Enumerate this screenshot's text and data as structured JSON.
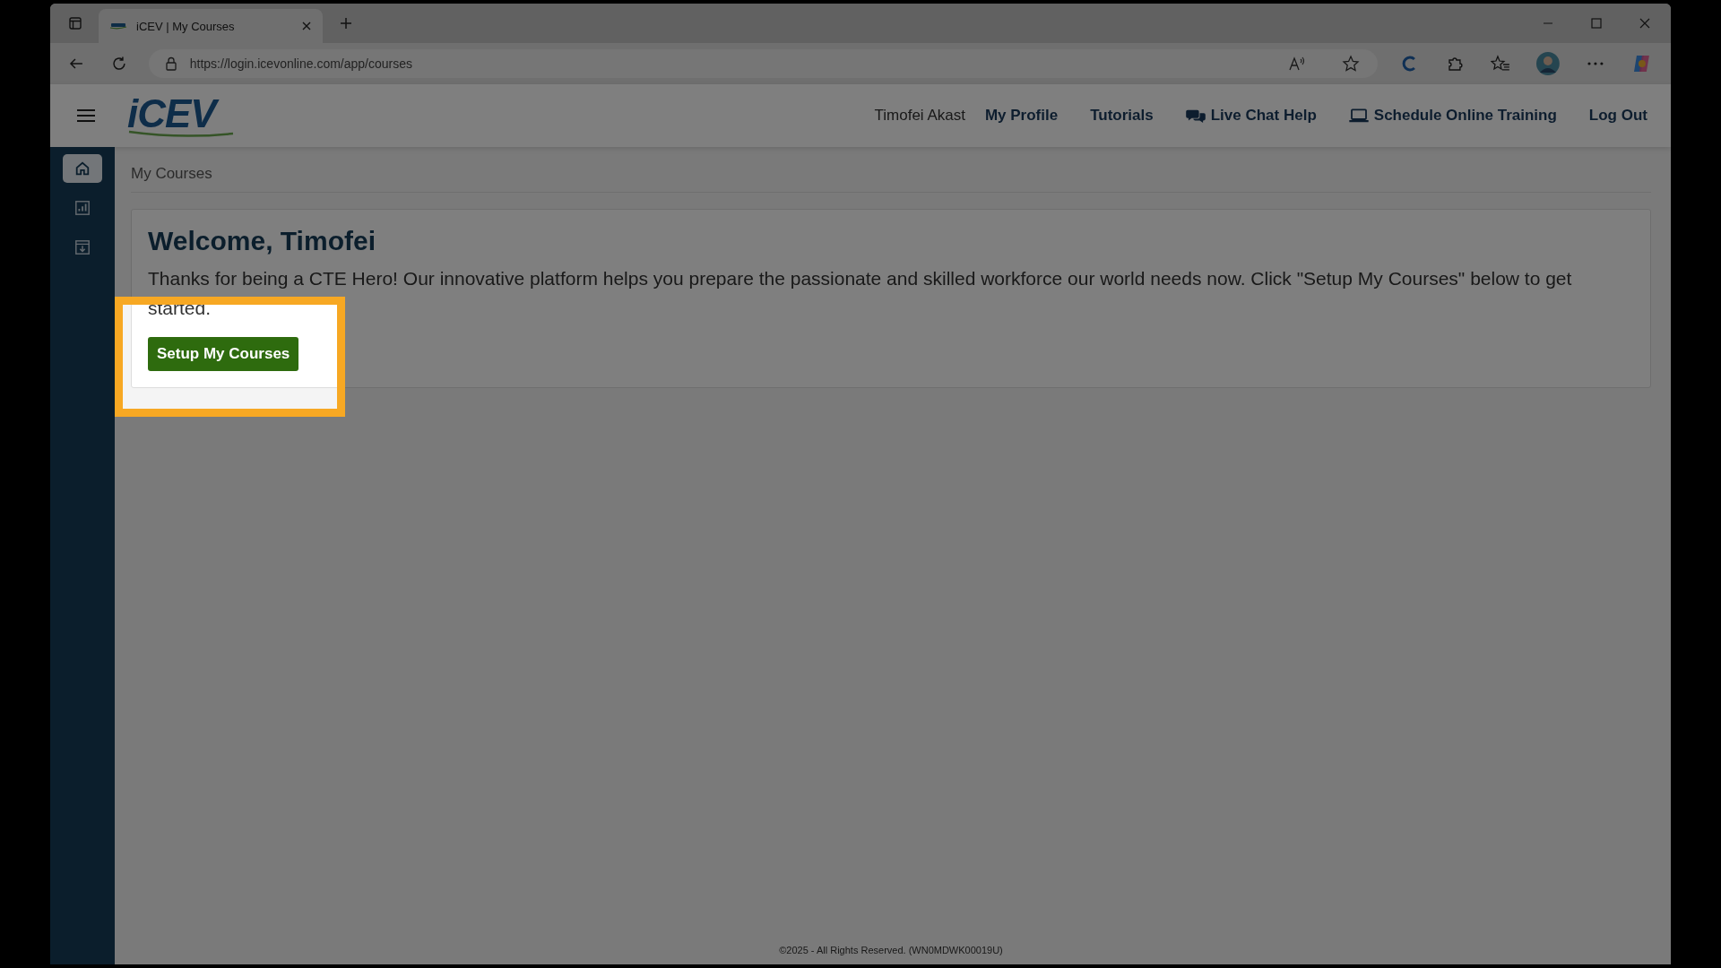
{
  "browser": {
    "tab_title": "iCEV | My Courses",
    "url": "https://login.icevonline.com/app/courses"
  },
  "header": {
    "logo": "iCEV",
    "user_name": "Timofei Akast",
    "links": [
      {
        "label": "My Profile",
        "kind": "plain"
      },
      {
        "label": "Tutorials",
        "kind": "plain"
      },
      {
        "label": "Live Chat Help",
        "kind": "chat"
      },
      {
        "label": "Schedule Online Training",
        "kind": "laptop"
      },
      {
        "label": "Log Out",
        "kind": "plain"
      }
    ]
  },
  "sidebar": {
    "items": [
      {
        "kind": "home",
        "selected": true
      },
      {
        "kind": "reports",
        "selected": false
      },
      {
        "kind": "download",
        "selected": false
      }
    ]
  },
  "breadcrumb": "My Courses",
  "welcome": {
    "title": "Welcome, Timofei",
    "text": "Thanks for being a CTE Hero! Our innovative platform helps you prepare the passionate and skilled workforce our world needs now. Click \"Setup My Courses\" below to get started.",
    "button": "Setup My Courses"
  },
  "footer": "©2025 - All Rights Reserved. (WN0MDWK00019U)"
}
